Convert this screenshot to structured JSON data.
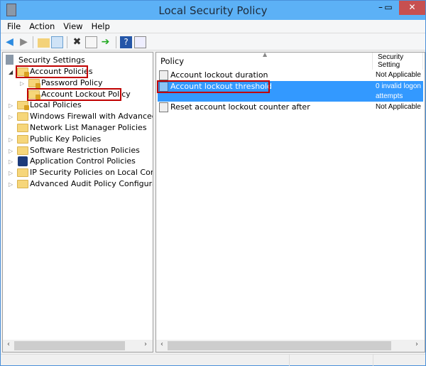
{
  "window": {
    "title": "Local Security Policy",
    "minimize": "–",
    "maximize": "▭",
    "close": "✕"
  },
  "menu": [
    "File",
    "Action",
    "View",
    "Help"
  ],
  "toolbar": {
    "icons": [
      "back-arrow-icon",
      "forward-arrow-icon",
      "up-folder-icon",
      "show-hide-tree-icon",
      "delete-icon",
      "properties-icon",
      "export-list-icon",
      "help-icon",
      "show-action-pane-icon"
    ]
  },
  "tree": {
    "root": "Security Settings",
    "items": [
      {
        "label": "Account Policies",
        "level": 1,
        "expanded": true,
        "highlighted": true
      },
      {
        "label": "Password Policy",
        "level": 2,
        "expandable": true
      },
      {
        "label": "Account Lockout Policy",
        "level": 2,
        "selected": true,
        "highlighted": true
      },
      {
        "label": "Local Policies",
        "level": 1,
        "expandable": true
      },
      {
        "label": "Windows Firewall with Advanced Security",
        "level": 1,
        "expandable": true
      },
      {
        "label": "Network List Manager Policies",
        "level": 1
      },
      {
        "label": "Public Key Policies",
        "level": 1,
        "expandable": true
      },
      {
        "label": "Software Restriction Policies",
        "level": 1,
        "expandable": true
      },
      {
        "label": "Application Control Policies",
        "level": 1,
        "expandable": true
      },
      {
        "label": "IP Security Policies on Local Computer",
        "level": 1,
        "expandable": true
      },
      {
        "label": "Advanced Audit Policy Configuration",
        "level": 1,
        "expandable": true
      }
    ]
  },
  "list": {
    "columns": [
      "Policy",
      "Security Setting"
    ],
    "rows": [
      {
        "policy": "Account lockout duration",
        "setting": "Not Applicable"
      },
      {
        "policy": "Account lockout threshold",
        "setting": "0 invalid logon attempts",
        "selected": true,
        "highlighted": true
      },
      {
        "policy": "Reset account lockout counter after",
        "setting": "Not Applicable"
      }
    ]
  },
  "colors": {
    "titlebar": "#5cb1f6",
    "selection": "#3399ff",
    "highlight_box": "#c00000",
    "close": "#c75050"
  }
}
